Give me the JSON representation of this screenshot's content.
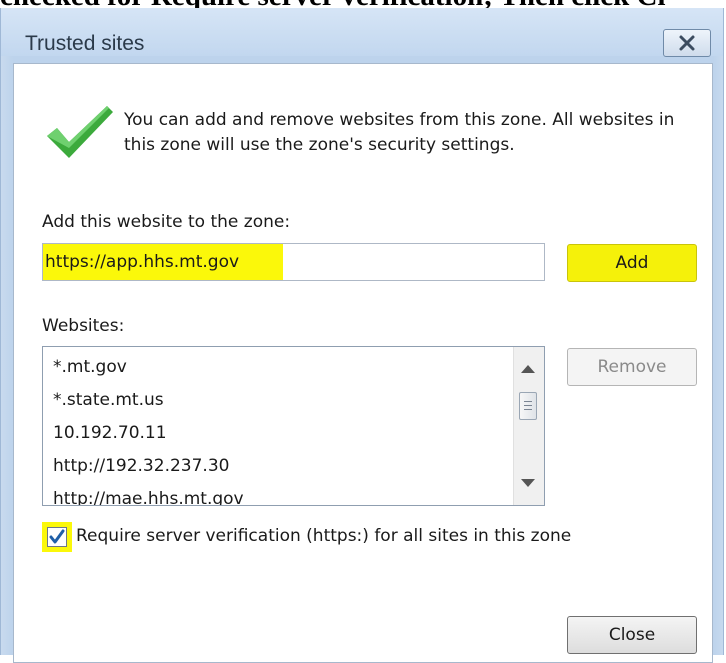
{
  "top_text": "checked for Require server verification; Then click Cl",
  "window": {
    "title": "Trusted sites"
  },
  "description": "You can add and remove websites from this zone. All websites in this zone will use the zone's security settings.",
  "add_section": {
    "label": "Add this website to the zone:",
    "value": "https://app.hhs.mt.gov",
    "add_label": "Add"
  },
  "websites": {
    "label": "Websites:",
    "items": [
      "*.mt.gov",
      "*.state.mt.us",
      "10.192.70.11",
      "http://192.32.237.30",
      "http://mae.hhs.mt.gov"
    ],
    "remove_label": "Remove"
  },
  "https_requirement": {
    "label": "Require server verification (https:) for all sites in this zone",
    "checked": true
  },
  "footer": {
    "close_label": "Close"
  },
  "colors": {
    "highlight": "#fbf80a",
    "check_green": "#3caa3c",
    "titlebar": "#c2d7ef"
  },
  "icons": {
    "zone": "green-checkmark-icon",
    "window_close": "close-icon"
  }
}
